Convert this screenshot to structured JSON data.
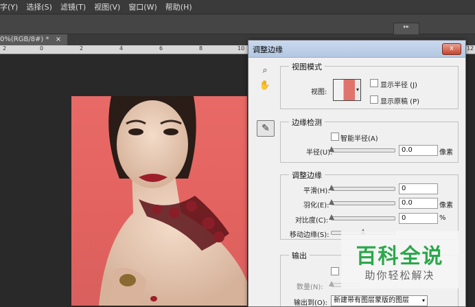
{
  "menubar": {
    "items": [
      "字(Y)",
      "选择(S)",
      "滤镜(T)",
      "视图(V)",
      "窗口(W)",
      "帮助(H)"
    ]
  },
  "document": {
    "tab_label": "0%(RGB/8#) *",
    "close_glyph": "×"
  },
  "ruler": {
    "ticks": [
      "2",
      "0",
      "2",
      "4",
      "6",
      "8",
      "10",
      "12"
    ]
  },
  "dialog": {
    "title": "调整边缘",
    "close_glyph": "x",
    "view_mode": {
      "legend": "视图模式",
      "view_label": "视图:",
      "show_radius": "显示半径 (J)",
      "show_original": "显示原稿 (P)"
    },
    "edge_detection": {
      "legend": "边缘检测",
      "smart_radius": "智能半径(A)",
      "radius_label": "半径(U):",
      "radius_value": "0.0",
      "radius_unit": "像素"
    },
    "adjust_edge": {
      "legend": "调整边缘",
      "smooth_label": "平滑(H):",
      "smooth_value": "0",
      "feather_label": "羽化(E):",
      "feather_value": "0.0",
      "feather_unit": "像素",
      "contrast_label": "对比度(C):",
      "contrast_value": "0",
      "contrast_unit": "%",
      "shift_label": "移动边缘(S):"
    },
    "output": {
      "legend": "输出",
      "amount_label": "数量(N):",
      "output_to_label": "输出到(O):",
      "output_to_value": "新建带有图层蒙版的图层"
    }
  },
  "watermark": {
    "line1": "百科全说",
    "line2": "助你轻松解决"
  },
  "icons": {
    "zoom": "magnifier-icon",
    "hand": "hand-icon",
    "brush": "refine-radius-brush-icon"
  }
}
